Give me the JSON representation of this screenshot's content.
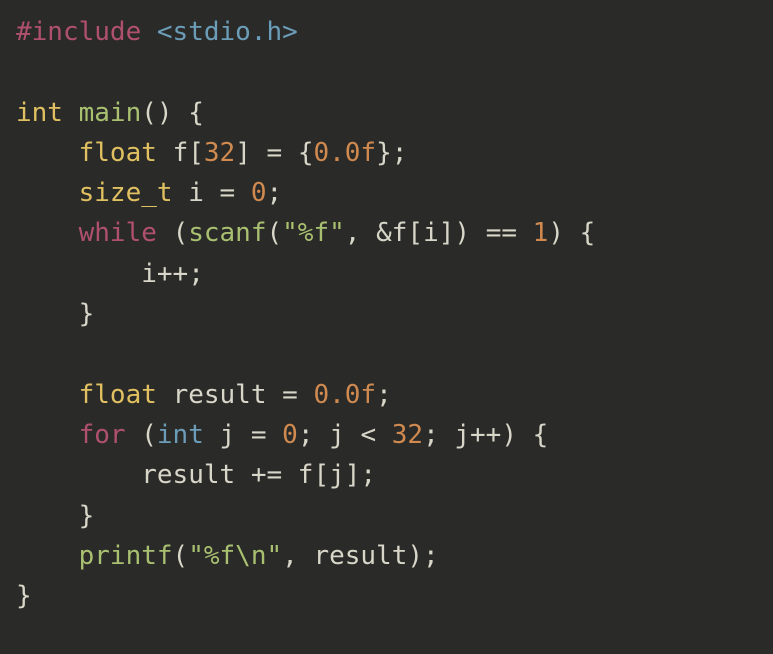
{
  "code": {
    "include_directive": "#include",
    "include_header": "<stdio.h>",
    "int_kw": "int",
    "main_fn": "main",
    "open_paren": "(",
    "close_paren": ")",
    "open_brace": "{",
    "close_brace": "}",
    "float_kw": "float",
    "arr_name": "f",
    "arr_size": "32",
    "init_zero_f": "0.0f",
    "size_t_kw": "size_t",
    "var_i": "i",
    "eq": "=",
    "zero": "0",
    "semi": ";",
    "while_kw": "while",
    "scanf_fn": "scanf",
    "fmt_f": "\"%f\"",
    "comma": ",",
    "amp": "&",
    "lbracket": "[",
    "rbracket": "]",
    "eqeq": "==",
    "one": "1",
    "ipp": "i++;",
    "result_name": "result",
    "for_kw": "for",
    "var_j": "j",
    "lt": "<",
    "jpp": "j++",
    "pluseq": "+=",
    "printf_fn": "printf",
    "fmt_fn": "\"%f\\n\"",
    "thirtytwo": "32"
  }
}
